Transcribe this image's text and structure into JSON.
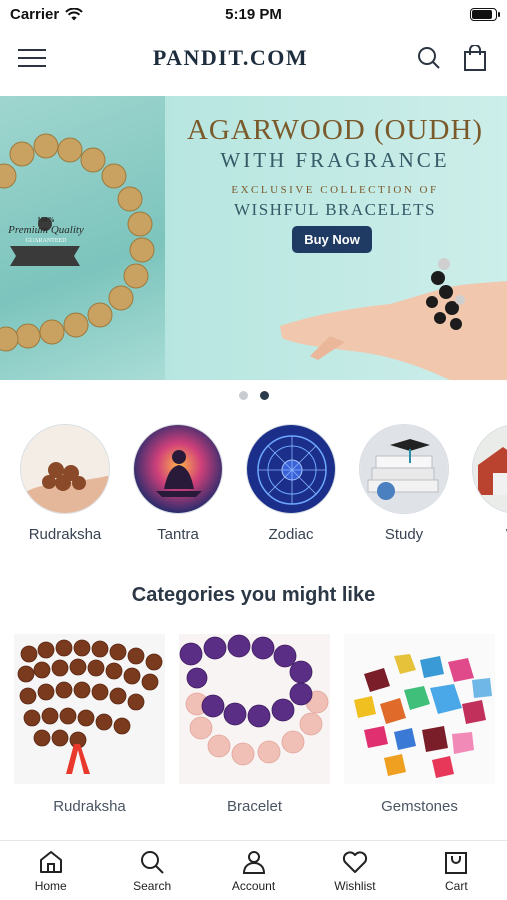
{
  "status_bar": {
    "carrier": "Carrier",
    "time": "5:19 PM",
    "battery_level": 0.9
  },
  "header": {
    "logo": "PANDIT.COM"
  },
  "banner": {
    "title": "AGARWOOD (OUDH)",
    "subtitle": "WITH FRAGRANCE",
    "small_text": "EXCLUSIVE COLLECTION OF",
    "wish_text": "WISHFUL BRACELETS",
    "button_label": "Buy Now",
    "badge_text": "Premium Quality",
    "badge_top": "100%",
    "badge_bottom": "GUARANTEED",
    "active_slide": 2,
    "slide_count": 2
  },
  "circle_categories": [
    {
      "label": "Rudraksha"
    },
    {
      "label": "Tantra"
    },
    {
      "label": "Zodiac"
    },
    {
      "label": "Study"
    },
    {
      "label": "We"
    }
  ],
  "section": {
    "title": "Categories you might like"
  },
  "category_cards": [
    {
      "label": "Rudraksha"
    },
    {
      "label": "Bracelet"
    },
    {
      "label": "Gemstones"
    }
  ],
  "tab_bar": [
    {
      "label": "Home",
      "icon": "home-icon"
    },
    {
      "label": "Search",
      "icon": "search-icon"
    },
    {
      "label": "Account",
      "icon": "account-icon"
    },
    {
      "label": "Wishlist",
      "icon": "heart-icon"
    },
    {
      "label": "Cart",
      "icon": "cart-icon"
    }
  ],
  "colors": {
    "brand_navy": "#1f3a63",
    "banner_teal": "#b8e6e0",
    "text_dark": "#2c3845"
  }
}
